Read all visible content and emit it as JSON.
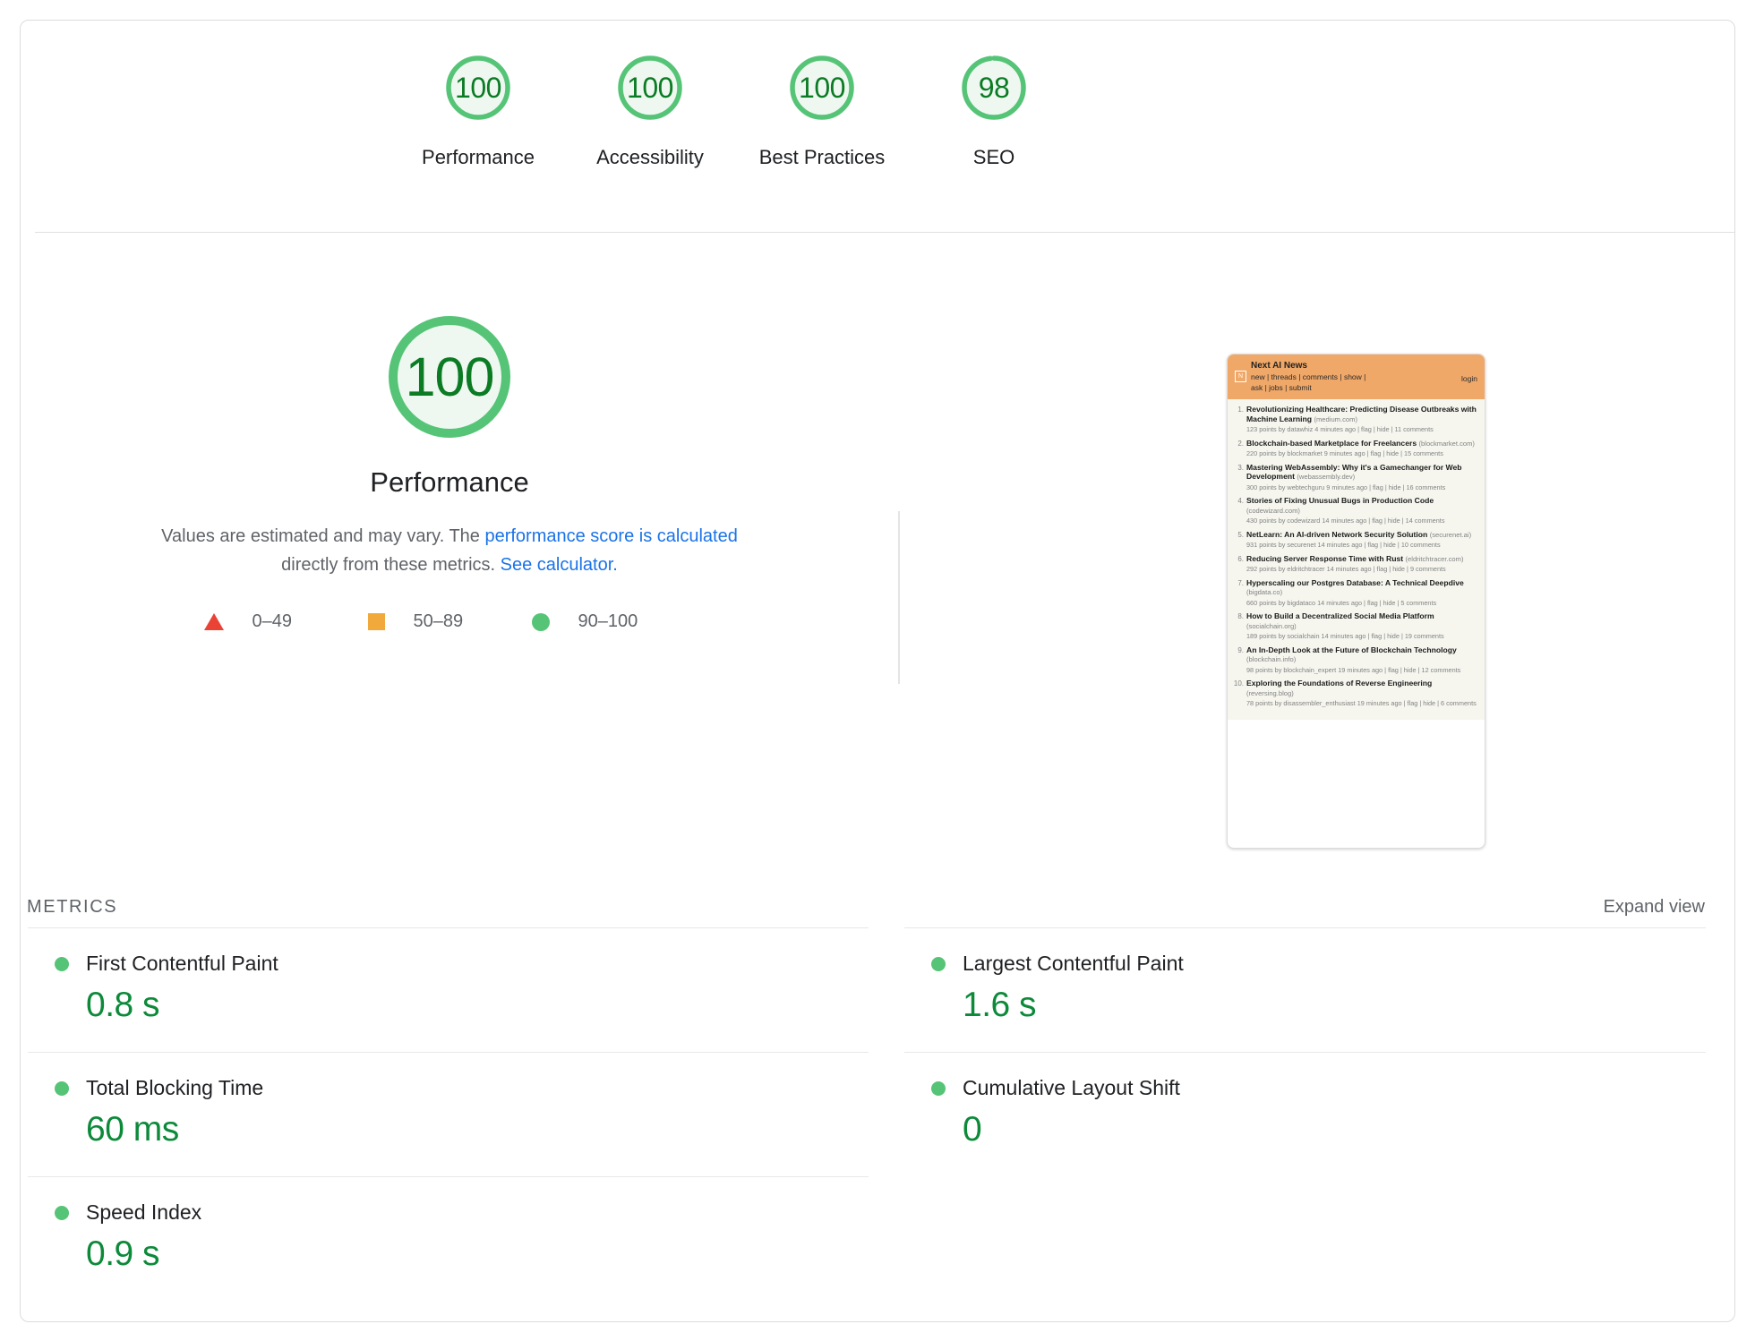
{
  "scores": [
    {
      "value": "100",
      "label": "Performance",
      "pct": 100,
      "color": "#56c477"
    },
    {
      "value": "100",
      "label": "Accessibility",
      "pct": 100,
      "color": "#56c477"
    },
    {
      "value": "100",
      "label": "Best Practices",
      "pct": 100,
      "color": "#56c477"
    },
    {
      "value": "98",
      "label": "SEO",
      "pct": 98,
      "color": "#56c477"
    }
  ],
  "category": {
    "score": "100",
    "title": "Performance",
    "desc_part1": "Values are estimated and may vary. The ",
    "link1": "performance score is calculated",
    "desc_part2": " directly from these metrics. ",
    "link2": "See calculator."
  },
  "legend": [
    {
      "shape": "triangle",
      "range": "0–49",
      "color": "#ea4335"
    },
    {
      "shape": "square",
      "range": "50–89",
      "color": "#f2a93b"
    },
    {
      "shape": "circle",
      "range": "90–100",
      "color": "#56c477"
    }
  ],
  "thumbnail": {
    "site_title": "Next AI News",
    "logo_letter": "N",
    "nav_line1": "new | threads | comments | show |",
    "nav_line2": "ask | jobs | submit",
    "login": "login",
    "stories": [
      {
        "rank": "1.",
        "title": "Revolutionizing Healthcare: Predicting Disease Outbreaks with Machine Learning",
        "domain": "(medium.com)",
        "sub": "123 points by datawhiz 4 minutes ago | flag | hide | 11 comments"
      },
      {
        "rank": "2.",
        "title": "Blockchain-based Marketplace for Freelancers",
        "domain": "(blockmarket.com)",
        "sub": "220 points by blockmarket 9 minutes ago | flag | hide | 15 comments"
      },
      {
        "rank": "3.",
        "title": "Mastering WebAssembly: Why it's a Gamechanger for Web Development",
        "domain": "(webassembly.dev)",
        "sub": "300 points by webtechguru 9 minutes ago | flag | hide | 16 comments"
      },
      {
        "rank": "4.",
        "title": "Stories of Fixing Unusual Bugs in Production Code",
        "domain": "(codewizard.com)",
        "sub": "430 points by codewizard 14 minutes ago | flag | hide | 14 comments"
      },
      {
        "rank": "5.",
        "title": "NetLearn: An AI-driven Network Security Solution",
        "domain": "(securenet.ai)",
        "sub": "931 points by securenet 14 minutes ago | flag | hide | 10 comments"
      },
      {
        "rank": "6.",
        "title": "Reducing Server Response Time with Rust",
        "domain": "(eldritchtracer.com)",
        "sub": "292 points by eldritchtracer 14 minutes ago | flag | hide | 9 comments"
      },
      {
        "rank": "7.",
        "title": "Hyperscaling our Postgres Database: A Technical Deepdive",
        "domain": "(bigdata.co)",
        "sub": "660 points by bigdataco 14 minutes ago | flag | hide | 5 comments"
      },
      {
        "rank": "8.",
        "title": "How to Build a Decentralized Social Media Platform",
        "domain": "(socialchain.org)",
        "sub": "189 points by socialchain 14 minutes ago | flag | hide | 19 comments"
      },
      {
        "rank": "9.",
        "title": "An In-Depth Look at the Future of Blockchain Technology",
        "domain": "(blockchain.info)",
        "sub": "98 points by blockchain_expert 19 minutes ago | flag | hide | 12 comments"
      },
      {
        "rank": "10.",
        "title": "Exploring the Foundations of Reverse Engineering",
        "domain": "(reversing.blog)",
        "sub": "78 points by disassembler_enthusiast 19 minutes ago | flag | hide | 6 comments"
      }
    ]
  },
  "metrics_section": {
    "title": "METRICS",
    "expand_label": "Expand view",
    "left": [
      {
        "name": "First Contentful Paint",
        "value": "0.8 s",
        "status": "pass"
      },
      {
        "name": "Total Blocking Time",
        "value": "60 ms",
        "status": "pass"
      },
      {
        "name": "Speed Index",
        "value": "0.9 s",
        "status": "pass"
      }
    ],
    "right": [
      {
        "name": "Largest Contentful Paint",
        "value": "1.6 s",
        "status": "pass"
      },
      {
        "name": "Cumulative Layout Shift",
        "value": "0",
        "status": "pass"
      }
    ]
  },
  "colors": {
    "pass": "#56c477",
    "pass_text": "#0c8a3a",
    "average": "#f2a93b",
    "fail": "#ea4335",
    "link": "#1a73e8"
  }
}
